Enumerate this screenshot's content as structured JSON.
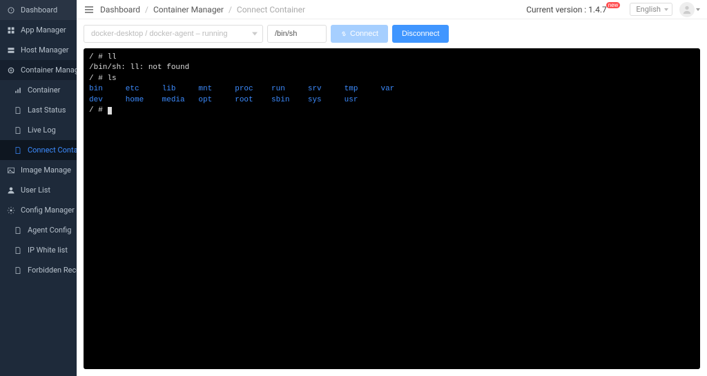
{
  "sidebar": {
    "items": [
      {
        "label": "Dashboard",
        "icon": "dashboard-icon"
      },
      {
        "label": "App Manager",
        "icon": "app-icon"
      },
      {
        "label": "Host Manager",
        "icon": "host-icon"
      },
      {
        "label": "Container Manager",
        "icon": "container-icon"
      },
      {
        "label": "Container",
        "icon": "bars-icon"
      },
      {
        "label": "Last Status",
        "icon": "doc-icon"
      },
      {
        "label": "Live Log",
        "icon": "doc-icon"
      },
      {
        "label": "Connect Container",
        "icon": "doc-icon"
      },
      {
        "label": "Image Manage",
        "icon": "image-icon"
      },
      {
        "label": "User List",
        "icon": "user-icon"
      },
      {
        "label": "Config Manager",
        "icon": "gear-icon"
      },
      {
        "label": "Agent Config",
        "icon": "doc-icon"
      },
      {
        "label": "IP White list",
        "icon": "doc-icon"
      },
      {
        "label": "Forbidden Record",
        "icon": "doc-icon"
      }
    ]
  },
  "header": {
    "breadcrumb": [
      "Dashboard",
      "Container Manager",
      "Connect Container"
    ],
    "version_label": "Current version : 1.4.7",
    "new_badge": "new",
    "lang": "English"
  },
  "controls": {
    "container_select": "docker-desktop / docker-agent – running",
    "shell_value": "/bin/sh",
    "connect_label": "Connect",
    "disconnect_label": "Disconnect"
  },
  "terminal": {
    "line1": "/ # ll",
    "line2": "/bin/sh: ll: not found",
    "line3": "/ # ls",
    "dirs_row1": "bin     etc     lib     mnt     proc    run     srv     tmp     var",
    "dirs_row2": "dev     home    media   opt     root    sbin    sys     usr",
    "prompt": "/ # "
  }
}
